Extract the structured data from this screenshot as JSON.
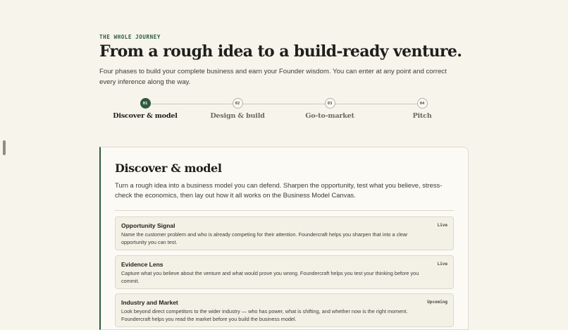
{
  "journey": {
    "eyebrow": "THE WHOLE JOURNEY",
    "title": "From a rough idea to a build-ready venture.",
    "intro": "Four phases to build your complete business and earn your Founder wisdom. You can enter at any point and correct every inference along the way."
  },
  "steps": [
    {
      "num": "01",
      "label": "Discover & model",
      "active": true
    },
    {
      "num": "02",
      "label": "Design & build",
      "active": false
    },
    {
      "num": "03",
      "label": "Go-to-market",
      "active": false
    },
    {
      "num": "04",
      "label": "Pitch",
      "active": false
    }
  ],
  "phase": {
    "title": "Discover & model",
    "description": "Turn a rough idea into a business model you can defend. Sharpen the opportunity, test what you believe, stress-check the economics, then lay out how it all works on the Business Model Canvas.",
    "items": [
      {
        "name": "Opportunity Signal",
        "status": "Live",
        "description": "Name the customer problem and who is already competing for their attention. Foundercraft helps you sharpen that into a clear opportunity you can test."
      },
      {
        "name": "Evidence Lens",
        "status": "Live",
        "description": "Capture what you believe about the venture and what would prove you wrong. Foundercraft helps you test your thinking before you commit."
      },
      {
        "name": "Industry and Market",
        "status": "Upcoming",
        "description": "Look beyond direct competitors to the wider industry — who has power, what is shifting, and whether now is the right moment. Foundercraft helps you read the market before you build the business model."
      }
    ]
  },
  "colors": {
    "accent": "#2e5a3e",
    "background": "#f7f4ec",
    "card": "#fbfaf5"
  }
}
